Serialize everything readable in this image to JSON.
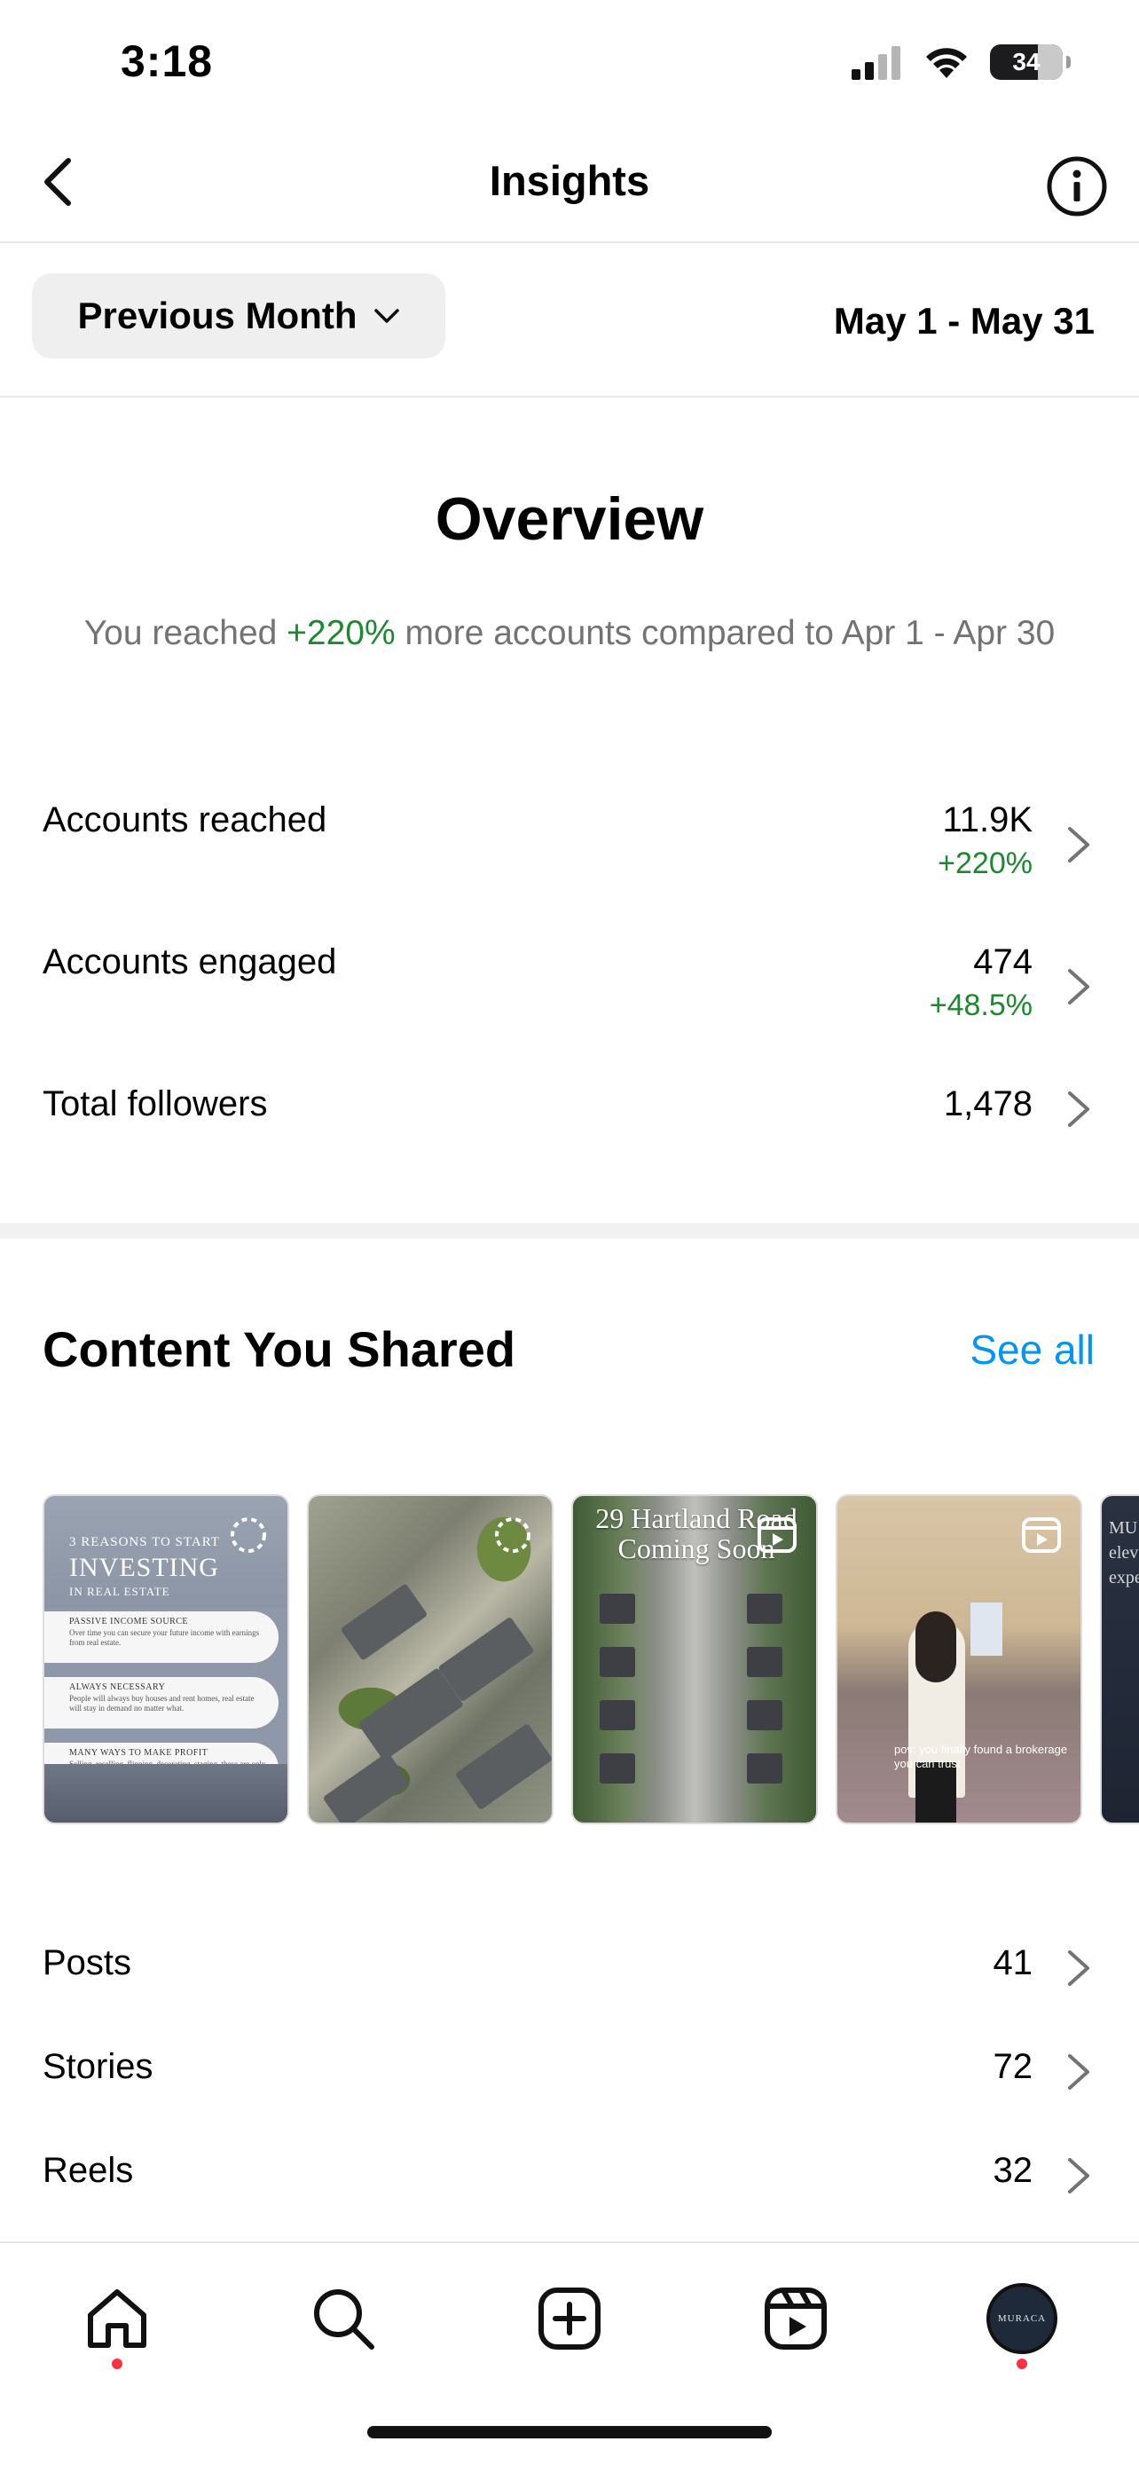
{
  "status": {
    "time": "3:18",
    "battery": "34"
  },
  "header": {
    "title": "Insights"
  },
  "filter": {
    "period_label": "Previous Month",
    "date_range": "May 1 - May 31"
  },
  "overview": {
    "title": "Overview",
    "desc_prefix": "You reached ",
    "desc_change": "+220%",
    "desc_suffix": " more accounts compared to Apr 1 - Apr 30"
  },
  "metrics": [
    {
      "label": "Accounts reached",
      "value": "11.9K",
      "change": "+220%"
    },
    {
      "label": "Accounts engaged",
      "value": "474",
      "change": "+48.5%"
    },
    {
      "label": "Total followers",
      "value": "1,478",
      "change": ""
    }
  ],
  "content": {
    "title": "Content You Shared",
    "see_all": "See all",
    "thumb1": {
      "small": "3 REASONS TO START",
      "big": "INVESTING",
      "sub": "IN REAL ESTATE",
      "items": [
        {
          "heading": "PASSIVE INCOME SOURCE",
          "text": "Over time you can secure your future income with earnings from real estate."
        },
        {
          "heading": "ALWAYS NECESSARY",
          "text": "People will always buy houses and rent homes, real estate will stay in demand no matter what."
        },
        {
          "heading": "MANY WAYS TO MAKE PROFIT",
          "text": "Selling, reselling, flipping, decorating, staging, these are only a few ways you can earn money."
        }
      ]
    },
    "thumb3_title": "29 Hartland Road Coming Soon",
    "thumb4_caption": "pov: you finally found a brokerage you can trust",
    "thumb5_text": "MU elevat experi",
    "avatar_text": "MURACA"
  },
  "summary": [
    {
      "label": "Posts",
      "value": "41"
    },
    {
      "label": "Stories",
      "value": "72"
    },
    {
      "label": "Reels",
      "value": "32"
    }
  ],
  "colors": {
    "positive": "#1b8a2e",
    "link": "#0095f6",
    "notification": "#ff3040"
  }
}
